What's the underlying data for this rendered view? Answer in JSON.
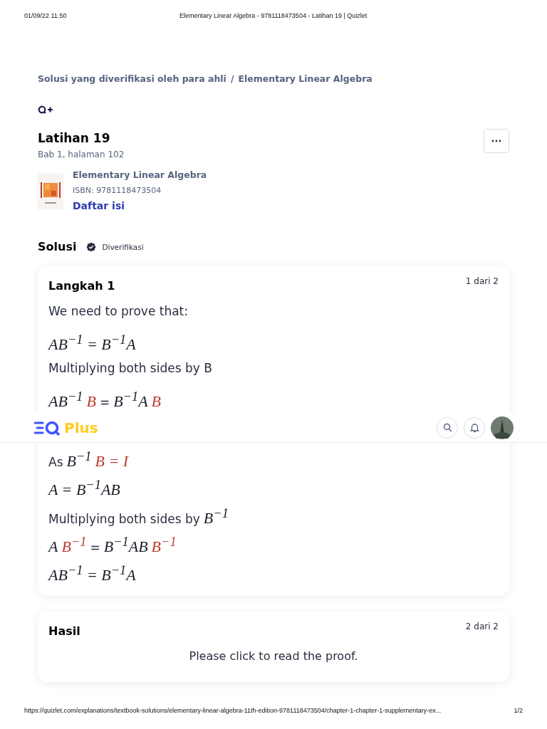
{
  "print_header": {
    "date": "01/09/22 11.50",
    "title": "Elementary Linear Algebra - 9781118473504 - Latihan 19 | Quizlet"
  },
  "breadcrumb": [
    {
      "label": "Solusi yang diverifikasi oleh para ahli"
    },
    {
      "label": "Elementary Linear Algebra"
    }
  ],
  "breadcrumb_separator": "/",
  "exercise": {
    "title": "Latihan 19",
    "subtitle": "Bab 1, halaman 102"
  },
  "book": {
    "title": "Elementary Linear Algebra",
    "isbn": "ISBN: 9781118473504",
    "link": "Daftar isi"
  },
  "solution": {
    "title": "Solusi",
    "badge": "Diverifikasi"
  },
  "steps": [
    {
      "kind": "step",
      "title": "Langkah 1",
      "counter": "1 dari 2",
      "lines": [
        {
          "parts": [
            {
              "kind": "text",
              "text": "We need to prove that:",
              "highlight": false
            }
          ]
        },
        {
          "parts": [
            {
              "kind": "math",
              "text": "AB$^{−1}$ = B$^{−1}$A",
              "highlight": false
            }
          ]
        },
        {
          "parts": [
            {
              "kind": "text",
              "text": "Multiplying both sides by B",
              "highlight": false
            }
          ]
        },
        {
          "parts": [
            {
              "kind": "math",
              "text": "AB$^{−1}$",
              "highlight": false
            },
            {
              "kind": "math",
              "text": "B",
              "highlight": true
            },
            {
              "kind": "text",
              "text": "=",
              "highlight": false
            },
            {
              "kind": "math",
              "text": "B$^{−1}$A",
              "highlight": false
            },
            {
              "kind": "math",
              "text": "B",
              "highlight": true
            }
          ]
        },
        {
          "parts": [
            {
              "kind": "text",
              "text": "As",
              "highlight": false
            },
            {
              "kind": "math",
              "text": "B$^{−1}$",
              "highlight": false
            },
            {
              "kind": "math",
              "text": "B = I",
              "highlight": true
            }
          ]
        },
        {
          "parts": [
            {
              "kind": "math",
              "text": "A = B$^{−1}$AB",
              "highlight": false
            }
          ]
        },
        {
          "parts": [
            {
              "kind": "text",
              "text": "Multiplying both sides by",
              "highlight": false
            },
            {
              "kind": "math",
              "text": "B$^{−1}$",
              "highlight": false
            }
          ]
        },
        {
          "parts": [
            {
              "kind": "math",
              "text": "A",
              "highlight": false
            },
            {
              "kind": "math",
              "text": "B$^{−1}$",
              "highlight": true
            },
            {
              "kind": "text",
              "text": "=",
              "highlight": false
            },
            {
              "kind": "math",
              "text": "B$^{−1}$AB",
              "highlight": false
            },
            {
              "kind": "math",
              "text": "B$^{−1}$",
              "highlight": true
            }
          ]
        },
        {
          "parts": [
            {
              "kind": "math",
              "text": "AB$^{−1}$ = B$^{−1}$A",
              "highlight": false
            }
          ]
        }
      ]
    },
    {
      "kind": "result",
      "title": "Hasil",
      "counter": "2 dari 2",
      "lines": [
        {
          "parts": [
            {
              "kind": "text",
              "text": "Please click to read the proof.",
              "highlight": false
            }
          ]
        }
      ]
    }
  ],
  "topbar": {
    "logo": "Plus"
  },
  "print_footer": {
    "url": "https://quizlet.com/explanations/textbook-solutions/elementary-linear-algebra-11th-edition-9781118473504/chapter-1-chapter-1-supplementary-ex...",
    "page": "1/2"
  }
}
